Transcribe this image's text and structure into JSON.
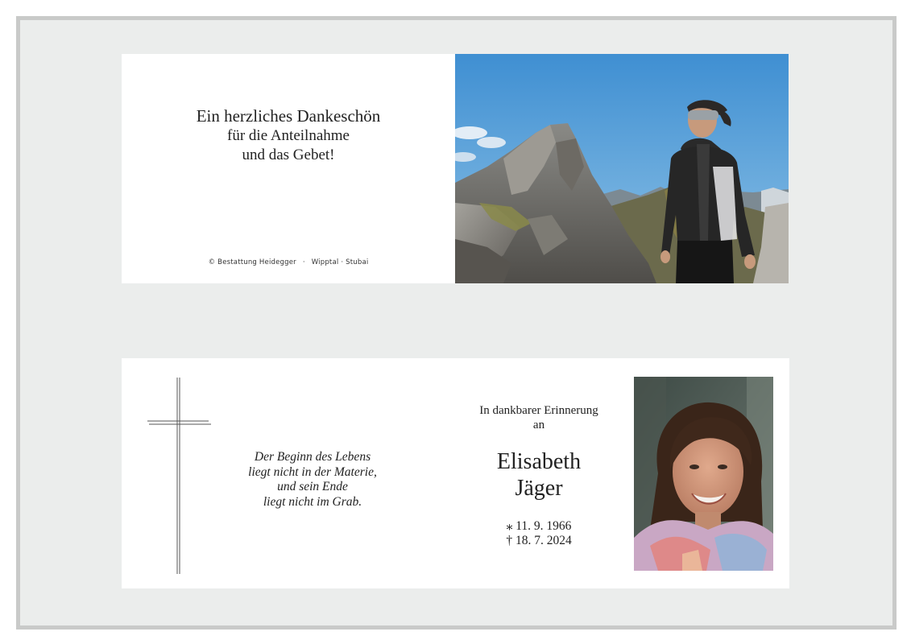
{
  "thank_you_card": {
    "line1": "Ein herzliches Dankeschön",
    "line2": "für die Anteilnahme",
    "line3": "und das Gebet!",
    "copyright": "© Bestattung Heidegger",
    "region": "Wipptal · Stubai",
    "separator": "·",
    "photo": "mountain-woman-photo"
  },
  "memorial_card": {
    "quote_lines": [
      "Der Beginn des Lebens",
      "liegt nicht in der Materie,",
      "und sein Ende",
      "liegt nicht im Grab."
    ],
    "memory_line1": "In dankbarer Erinnerung",
    "memory_line2": "an",
    "first_name": "Elisabeth",
    "last_name": "Jäger",
    "birth": "⁎ 11. 9. 1966",
    "death": "† 18. 7. 2024",
    "cross_icon": "cross-icon",
    "photo": "portrait-photo"
  },
  "colors": {
    "frame_border": "#c9cac9",
    "frame_background": "#ebedec",
    "card_background": "#ffffff",
    "text": "#222222",
    "sky": "#4d9ad6"
  }
}
